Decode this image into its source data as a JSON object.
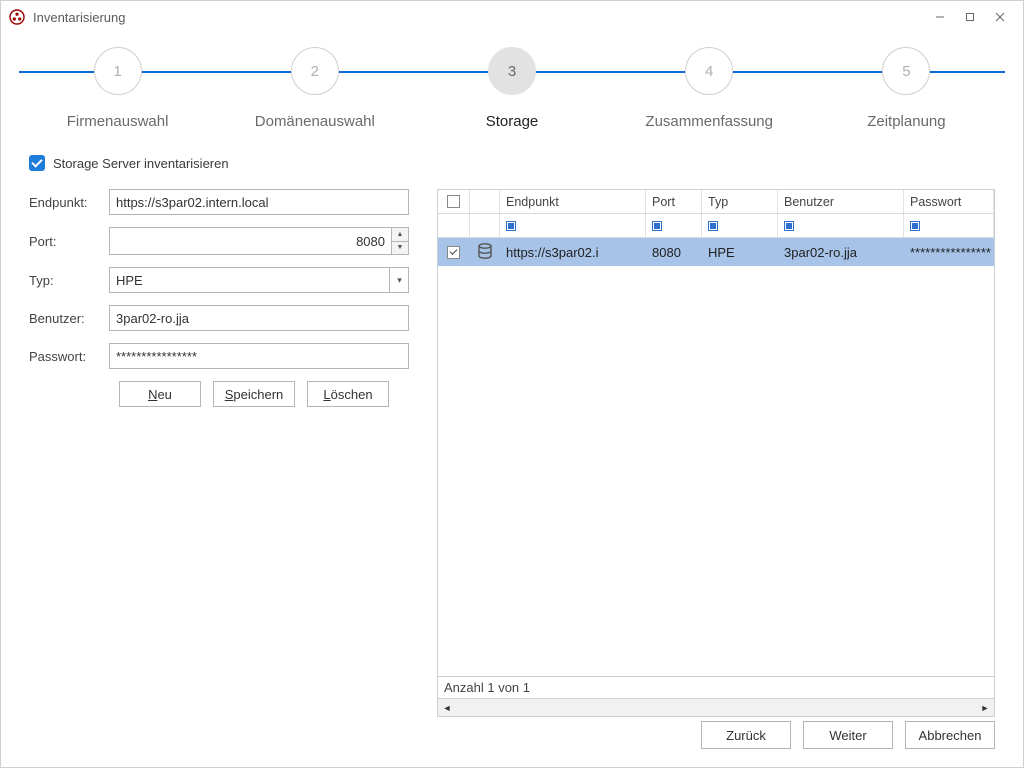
{
  "window": {
    "title": "Inventarisierung"
  },
  "stepper": {
    "steps": [
      {
        "num": "1",
        "label": "Firmenauswahl"
      },
      {
        "num": "2",
        "label": "Domänenauswahl"
      },
      {
        "num": "3",
        "label": "Storage"
      },
      {
        "num": "4",
        "label": "Zusammenfassung"
      },
      {
        "num": "5",
        "label": "Zeitplanung"
      }
    ],
    "current_index": 2
  },
  "checkbox": {
    "label": "Storage Server inventarisieren",
    "checked": true
  },
  "form": {
    "labels": {
      "endpunkt": "Endpunkt:",
      "port": "Port:",
      "typ": "Typ:",
      "benutzer": "Benutzer:",
      "passwort": "Passwort:"
    },
    "endpunkt": "https://s3par02.intern.local",
    "port": "8080",
    "typ": "HPE",
    "benutzer": "3par02-ro.jja",
    "passwort": "****************"
  },
  "buttons": {
    "neu": "Neu",
    "speichern": "Speichern",
    "loeschen": "Löschen"
  },
  "grid": {
    "columns": {
      "endpunkt": "Endpunkt",
      "port": "Port",
      "typ": "Typ",
      "benutzer": "Benutzer",
      "passwort": "Passwort"
    },
    "rows": [
      {
        "checked": true,
        "endpunkt": "https://s3par02.i",
        "port": "8080",
        "typ": "HPE",
        "benutzer": "3par02-ro.jja",
        "passwort": "****************"
      }
    ],
    "footer": "Anzahl 1 von 1"
  },
  "nav": {
    "zurueck": "Zurück",
    "weiter": "Weiter",
    "abbrechen": "Abbrechen"
  }
}
